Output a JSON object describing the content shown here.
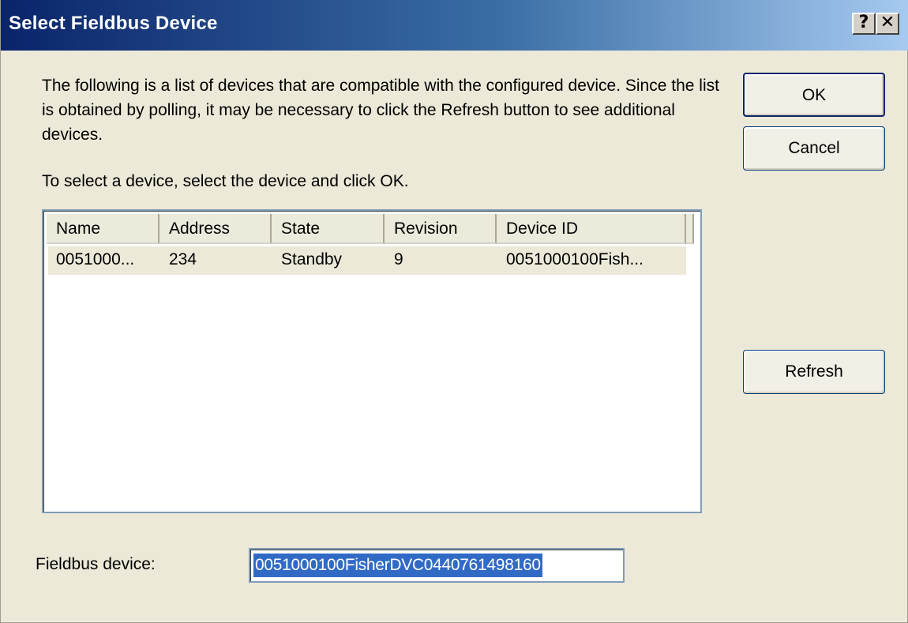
{
  "window": {
    "title": "Select Fieldbus Device",
    "help_button": "?",
    "close_button": "✕"
  },
  "instructions": {
    "paragraph1": "The following is a list of devices that are compatible with the configured device. Since the list is obtained by polling, it may be necessary to click the Refresh button to see additional devices.",
    "paragraph2": "To select a device, select the device and click OK."
  },
  "buttons": {
    "ok": "OK",
    "cancel": "Cancel",
    "refresh": "Refresh"
  },
  "device_list": {
    "columns": [
      "Name",
      "Address",
      "State",
      "Revision",
      "Device ID"
    ],
    "rows": [
      {
        "name": "0051000...",
        "address": "234",
        "state": "Standby",
        "revision": "9",
        "device_id": "0051000100Fish..."
      }
    ]
  },
  "fieldbus_device": {
    "label": "Fieldbus device:",
    "value": "0051000100FisherDVC0440761498160"
  },
  "colors": {
    "titlebar_start": "#0a246a",
    "titlebar_end": "#a6caf0",
    "dialog_background": "#ece9d8",
    "selection": "#316ac5"
  }
}
